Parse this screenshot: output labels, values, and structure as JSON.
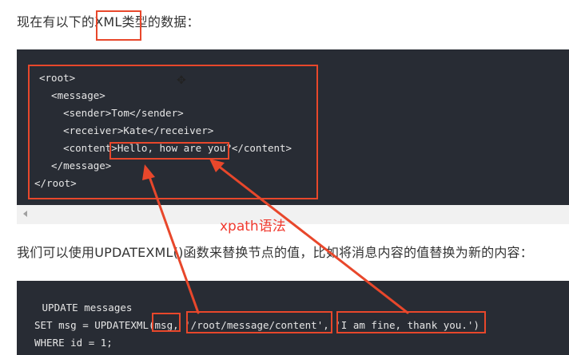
{
  "intro_text": "现在有以下的XML类型的数据：",
  "xml_lines": [
    "<root>",
    "  <message>",
    "    <sender>Tom</sender>",
    "    <receiver>Kate</receiver>",
    "    <content>Hello, how are you?</content>",
    "  </message>",
    "</root>"
  ],
  "annotation": "xpath语法",
  "explain_text": "我们可以使用UPDATEXML()函数来替换节点的值，比如将消息内容的值替换为新的内容：",
  "sql_lines": [
    " UPDATE messages",
    "SET msg = UPDATEXML(msg, '/root/message/content', 'I am fine, thank you.')",
    "WHERE id = 1;"
  ],
  "colors": {
    "highlight": "#e8472b",
    "code_bg": "#282c34"
  }
}
